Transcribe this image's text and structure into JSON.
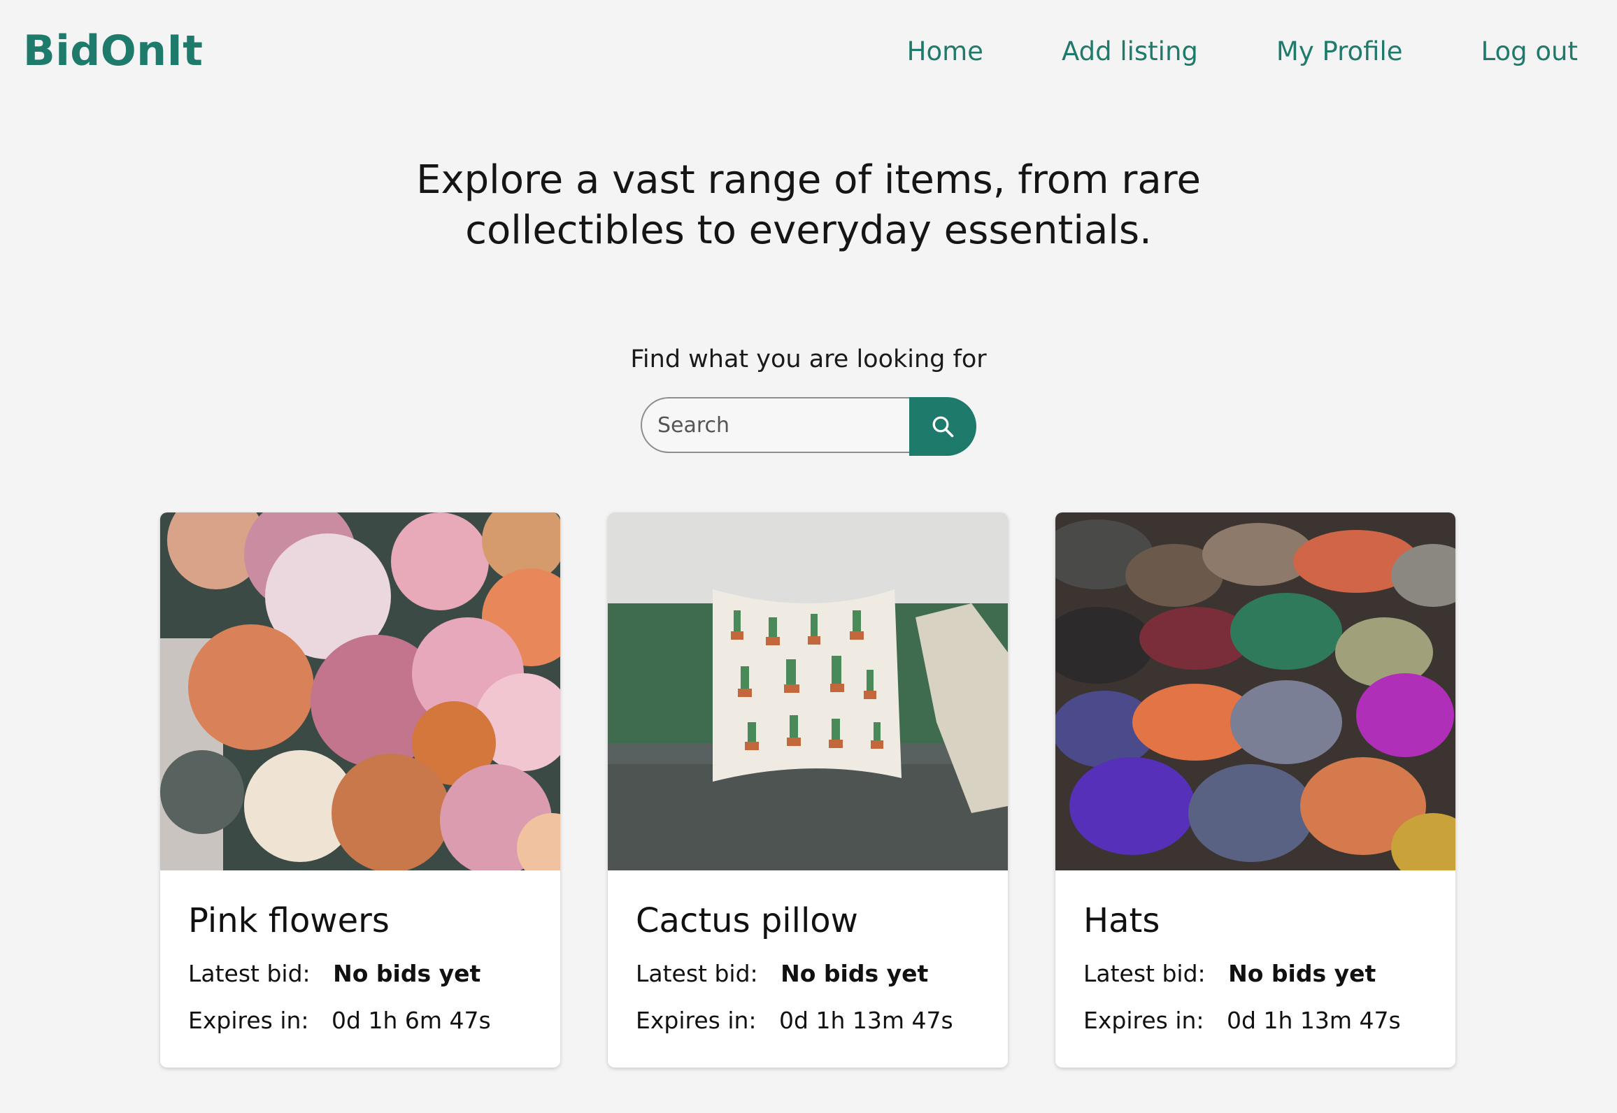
{
  "app": {
    "logo": "BidOnIt",
    "brand_color": "#1e7a6b"
  },
  "nav": {
    "items": [
      {
        "label": "Home"
      },
      {
        "label": "Add listing"
      },
      {
        "label": "My Profile"
      },
      {
        "label": "Log out"
      }
    ]
  },
  "hero": {
    "line1": "Explore a vast range of items, from rare",
    "line2": "collectibles to everyday essentials."
  },
  "search": {
    "label": "Find what you are looking for",
    "placeholder": "Search",
    "value": "",
    "button_icon": "search-icon"
  },
  "listings": [
    {
      "title": "Pink flowers",
      "latest_bid_label": "Latest bid:",
      "latest_bid_value": "No bids yet",
      "expires_label": "Expires in:",
      "expires_value": "0d 1h 6m 47s"
    },
    {
      "title": "Cactus pillow",
      "latest_bid_label": "Latest bid:",
      "latest_bid_value": "No bids yet",
      "expires_label": "Expires in:",
      "expires_value": "0d 1h 13m 47s"
    },
    {
      "title": "Hats",
      "latest_bid_label": "Latest bid:",
      "latest_bid_value": "No bids yet",
      "expires_label": "Expires in:",
      "expires_value": "0d 1h 13m 47s"
    }
  ]
}
